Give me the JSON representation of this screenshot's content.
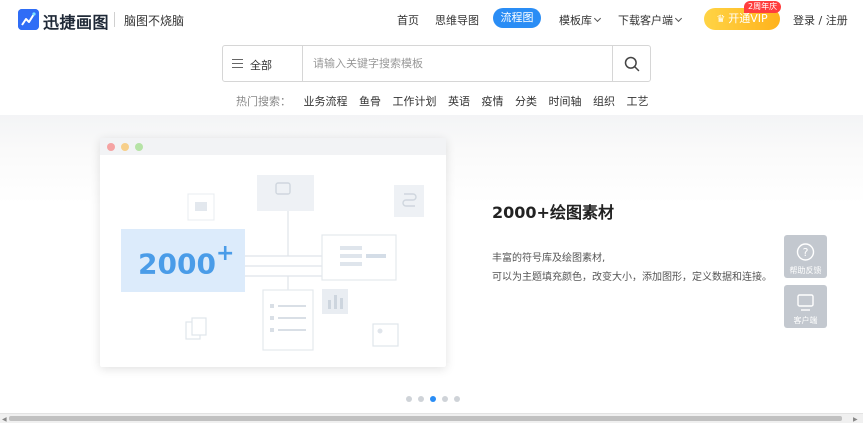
{
  "header": {
    "brand": "迅捷画图",
    "slogan": "脑图不烧脑",
    "nav": {
      "home": "首页",
      "mindmap": "思维导图",
      "flowchart": "流程图",
      "templates": "模板库",
      "download": "下载客户端"
    },
    "vip": {
      "label": "开通VIP",
      "badge": "2周年庆"
    },
    "login": "登录 / 注册"
  },
  "search": {
    "category": "全部",
    "placeholder": "请输入关键字搜索模板",
    "value": ""
  },
  "hot_search": {
    "label": "热门搜索：",
    "items": [
      "业务流程",
      "鱼骨",
      "工作计划",
      "英语",
      "疫情",
      "分类",
      "时间轴",
      "组织",
      "工艺"
    ]
  },
  "banner": {
    "illustration_number": "2000",
    "illustration_sup": "+",
    "title": "2000+绘图素材",
    "desc_line1": "丰富的符号库及绘图素材,",
    "desc_line2": "可以为主题填充颜色，改变大小，添加图形，定义数据和连接。",
    "slides": {
      "count": 5,
      "active_index": 2
    }
  },
  "side_tools": {
    "help": "帮助反馈",
    "client": "客户端"
  },
  "colors": {
    "accent": "#2a8df5",
    "vip_gold": "#ffc22e",
    "badge_red": "#ff3d3d",
    "illustration_blue": "#dcebfb",
    "illustration_text": "#4a9ce8"
  },
  "icons": {
    "logo": "chart-trend-icon",
    "menu": "menu-icon",
    "search": "search-icon",
    "crown": "crown-icon",
    "help": "question-icon",
    "client": "monitor-icon"
  }
}
